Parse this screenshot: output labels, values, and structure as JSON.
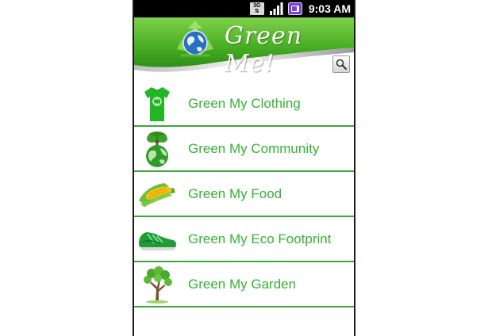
{
  "status_bar": {
    "network_label": "3G",
    "time": "9:03 AM",
    "icons": [
      "network-3g-icon",
      "signal-icon",
      "battery-icon"
    ]
  },
  "header": {
    "title": "Green Me!",
    "logo": "recycling-globe-icon"
  },
  "search": {
    "icon": "search-icon"
  },
  "menu": {
    "items": [
      {
        "label": "Green My Clothing",
        "icon": "tshirt-icon"
      },
      {
        "label": "Green My Community",
        "icon": "earth-tree-icon"
      },
      {
        "label": "Green My Food",
        "icon": "corn-icon"
      },
      {
        "label": "Green My Eco Footprint",
        "icon": "sneaker-icon"
      },
      {
        "label": "Green My Garden",
        "icon": "tree-icon"
      }
    ]
  },
  "colors": {
    "accent_green": "#34b234",
    "header_green": "#4cb32a",
    "divider": "#3aa83a",
    "status_bar": "#000000"
  }
}
